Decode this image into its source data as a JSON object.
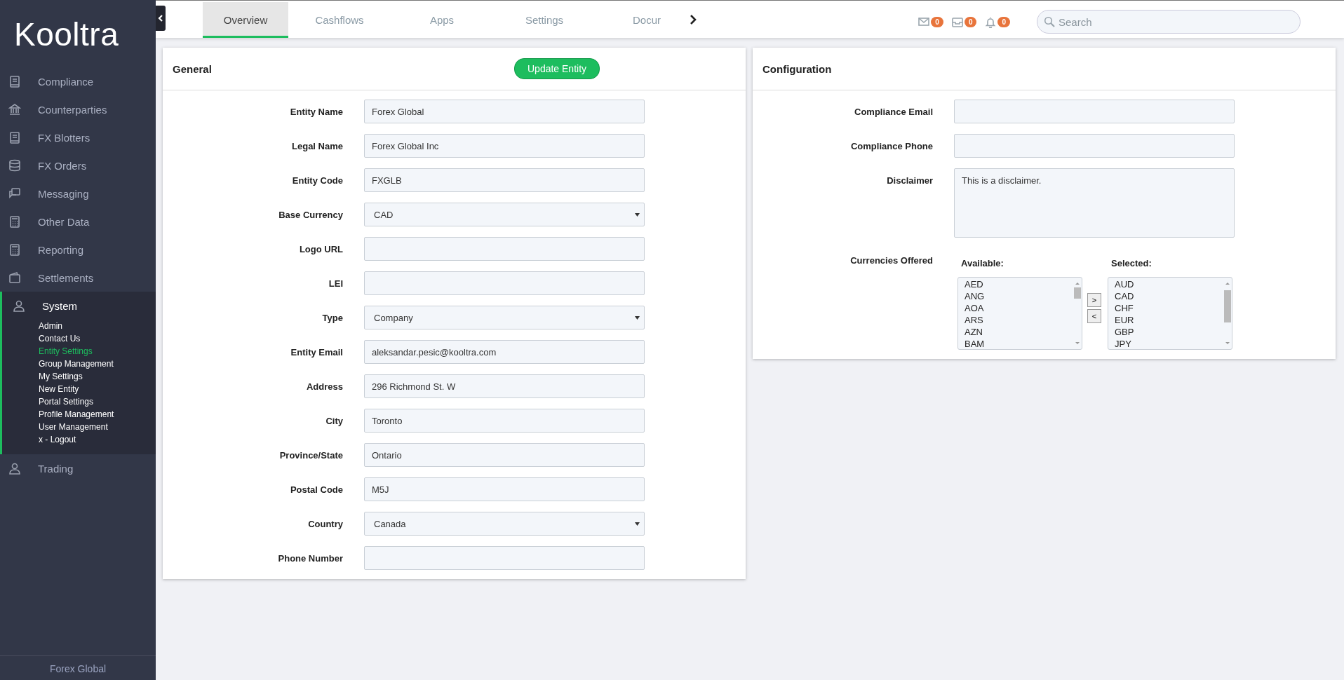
{
  "sidebar": {
    "logo": "Kooltra",
    "items": [
      {
        "label": "Compliance",
        "kind": "book",
        "expanded": false
      },
      {
        "label": "Counterparties",
        "kind": "bank",
        "expanded": false
      },
      {
        "label": "FX Blotters",
        "kind": "book",
        "expanded": false
      },
      {
        "label": "FX Orders",
        "kind": "database",
        "expanded": false
      },
      {
        "label": "Messaging",
        "kind": "chat",
        "expanded": false
      },
      {
        "label": "Other Data",
        "kind": "calculator",
        "expanded": false
      },
      {
        "label": "Reporting",
        "kind": "calculator",
        "expanded": false
      },
      {
        "label": "Settlements",
        "kind": "wallet",
        "expanded": false
      },
      {
        "label": "System",
        "kind": "user",
        "expanded": true,
        "children": [
          {
            "label": "Admin",
            "selected": false
          },
          {
            "label": "Contact Us",
            "selected": false
          },
          {
            "label": "Entity Settings",
            "selected": true
          },
          {
            "label": "Group Management",
            "selected": false
          },
          {
            "label": "My Settings",
            "selected": false
          },
          {
            "label": "New Entity",
            "selected": false
          },
          {
            "label": "Portal Settings",
            "selected": false
          },
          {
            "label": "Profile Management",
            "selected": false
          },
          {
            "label": "User Management",
            "selected": false
          },
          {
            "label": "x - Logout",
            "selected": false
          }
        ]
      },
      {
        "label": "Trading",
        "kind": "user",
        "expanded": false
      }
    ],
    "footer": "Forex Global"
  },
  "tabs": [
    {
      "label": "Overview",
      "selected": true
    },
    {
      "label": "Cashflows",
      "selected": false
    },
    {
      "label": "Apps",
      "selected": false
    },
    {
      "label": "Settings",
      "selected": false
    },
    {
      "label": "Docur",
      "selected": false
    }
  ],
  "notifications": [
    {
      "kind": "mail",
      "count": "0"
    },
    {
      "kind": "inbox",
      "count": "0"
    },
    {
      "kind": "bell",
      "count": "0"
    }
  ],
  "search": {
    "placeholder": "Search"
  },
  "general": {
    "title": "General",
    "button": "Update Entity",
    "fields": [
      {
        "label": "Entity Name",
        "kind": "text",
        "value": "Forex Global"
      },
      {
        "label": "Legal Name",
        "kind": "text",
        "value": "Forex Global Inc"
      },
      {
        "label": "Entity Code",
        "kind": "text",
        "value": "FXGLB"
      },
      {
        "label": "Base Currency",
        "kind": "select",
        "value": "CAD"
      },
      {
        "label": "Logo URL",
        "kind": "text"
      },
      {
        "label": "LEI",
        "kind": "text"
      },
      {
        "label": "Type",
        "kind": "select",
        "value": "Company"
      },
      {
        "label": "Entity Email",
        "kind": "text",
        "value": "aleksandar.pesic@kooltra.com"
      },
      {
        "label": "Address",
        "kind": "text",
        "value": "296 Richmond St. W"
      },
      {
        "label": "City",
        "kind": "text",
        "value": "Toronto"
      },
      {
        "label": "Province/State",
        "kind": "text",
        "value": "Ontario"
      },
      {
        "label": "Postal Code",
        "kind": "text",
        "value": "M5J"
      },
      {
        "label": "Country",
        "kind": "select",
        "value": "Canada"
      },
      {
        "label": "Phone Number",
        "kind": "text"
      }
    ]
  },
  "configuration": {
    "title": "Configuration",
    "fields": [
      {
        "label": "Compliance Email",
        "kind": "text"
      },
      {
        "label": "Compliance Phone",
        "kind": "text"
      },
      {
        "label": "Disclaimer",
        "kind": "textarea",
        "value": "This is a disclaimer."
      }
    ],
    "currencies": {
      "label": "Currencies Offered",
      "available_label": "Available:",
      "available": [
        "AED",
        "ANG",
        "AOA",
        "ARS",
        "AZN",
        "BAM"
      ],
      "selected_label": "Selected:",
      "selected": [
        "AUD",
        "CAD",
        "CHF",
        "EUR",
        "GBP",
        "JPY"
      ],
      "buttons": [
        ">",
        "<"
      ]
    }
  }
}
